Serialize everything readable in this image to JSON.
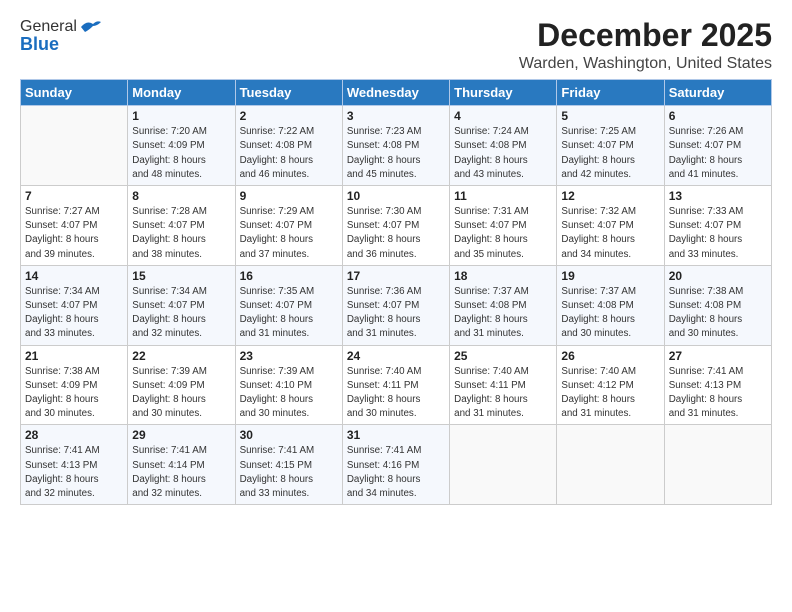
{
  "logo": {
    "line1": "General",
    "line2": "Blue"
  },
  "title": "December 2025",
  "subtitle": "Warden, Washington, United States",
  "days_of_week": [
    "Sunday",
    "Monday",
    "Tuesday",
    "Wednesday",
    "Thursday",
    "Friday",
    "Saturday"
  ],
  "weeks": [
    [
      {
        "day": "",
        "info": ""
      },
      {
        "day": "1",
        "info": "Sunrise: 7:20 AM\nSunset: 4:09 PM\nDaylight: 8 hours\nand 48 minutes."
      },
      {
        "day": "2",
        "info": "Sunrise: 7:22 AM\nSunset: 4:08 PM\nDaylight: 8 hours\nand 46 minutes."
      },
      {
        "day": "3",
        "info": "Sunrise: 7:23 AM\nSunset: 4:08 PM\nDaylight: 8 hours\nand 45 minutes."
      },
      {
        "day": "4",
        "info": "Sunrise: 7:24 AM\nSunset: 4:08 PM\nDaylight: 8 hours\nand 43 minutes."
      },
      {
        "day": "5",
        "info": "Sunrise: 7:25 AM\nSunset: 4:07 PM\nDaylight: 8 hours\nand 42 minutes."
      },
      {
        "day": "6",
        "info": "Sunrise: 7:26 AM\nSunset: 4:07 PM\nDaylight: 8 hours\nand 41 minutes."
      }
    ],
    [
      {
        "day": "7",
        "info": "Sunrise: 7:27 AM\nSunset: 4:07 PM\nDaylight: 8 hours\nand 39 minutes."
      },
      {
        "day": "8",
        "info": "Sunrise: 7:28 AM\nSunset: 4:07 PM\nDaylight: 8 hours\nand 38 minutes."
      },
      {
        "day": "9",
        "info": "Sunrise: 7:29 AM\nSunset: 4:07 PM\nDaylight: 8 hours\nand 37 minutes."
      },
      {
        "day": "10",
        "info": "Sunrise: 7:30 AM\nSunset: 4:07 PM\nDaylight: 8 hours\nand 36 minutes."
      },
      {
        "day": "11",
        "info": "Sunrise: 7:31 AM\nSunset: 4:07 PM\nDaylight: 8 hours\nand 35 minutes."
      },
      {
        "day": "12",
        "info": "Sunrise: 7:32 AM\nSunset: 4:07 PM\nDaylight: 8 hours\nand 34 minutes."
      },
      {
        "day": "13",
        "info": "Sunrise: 7:33 AM\nSunset: 4:07 PM\nDaylight: 8 hours\nand 33 minutes."
      }
    ],
    [
      {
        "day": "14",
        "info": "Sunrise: 7:34 AM\nSunset: 4:07 PM\nDaylight: 8 hours\nand 33 minutes."
      },
      {
        "day": "15",
        "info": "Sunrise: 7:34 AM\nSunset: 4:07 PM\nDaylight: 8 hours\nand 32 minutes."
      },
      {
        "day": "16",
        "info": "Sunrise: 7:35 AM\nSunset: 4:07 PM\nDaylight: 8 hours\nand 31 minutes."
      },
      {
        "day": "17",
        "info": "Sunrise: 7:36 AM\nSunset: 4:07 PM\nDaylight: 8 hours\nand 31 minutes."
      },
      {
        "day": "18",
        "info": "Sunrise: 7:37 AM\nSunset: 4:08 PM\nDaylight: 8 hours\nand 31 minutes."
      },
      {
        "day": "19",
        "info": "Sunrise: 7:37 AM\nSunset: 4:08 PM\nDaylight: 8 hours\nand 30 minutes."
      },
      {
        "day": "20",
        "info": "Sunrise: 7:38 AM\nSunset: 4:08 PM\nDaylight: 8 hours\nand 30 minutes."
      }
    ],
    [
      {
        "day": "21",
        "info": "Sunrise: 7:38 AM\nSunset: 4:09 PM\nDaylight: 8 hours\nand 30 minutes."
      },
      {
        "day": "22",
        "info": "Sunrise: 7:39 AM\nSunset: 4:09 PM\nDaylight: 8 hours\nand 30 minutes."
      },
      {
        "day": "23",
        "info": "Sunrise: 7:39 AM\nSunset: 4:10 PM\nDaylight: 8 hours\nand 30 minutes."
      },
      {
        "day": "24",
        "info": "Sunrise: 7:40 AM\nSunset: 4:11 PM\nDaylight: 8 hours\nand 30 minutes."
      },
      {
        "day": "25",
        "info": "Sunrise: 7:40 AM\nSunset: 4:11 PM\nDaylight: 8 hours\nand 31 minutes."
      },
      {
        "day": "26",
        "info": "Sunrise: 7:40 AM\nSunset: 4:12 PM\nDaylight: 8 hours\nand 31 minutes."
      },
      {
        "day": "27",
        "info": "Sunrise: 7:41 AM\nSunset: 4:13 PM\nDaylight: 8 hours\nand 31 minutes."
      }
    ],
    [
      {
        "day": "28",
        "info": "Sunrise: 7:41 AM\nSunset: 4:13 PM\nDaylight: 8 hours\nand 32 minutes."
      },
      {
        "day": "29",
        "info": "Sunrise: 7:41 AM\nSunset: 4:14 PM\nDaylight: 8 hours\nand 32 minutes."
      },
      {
        "day": "30",
        "info": "Sunrise: 7:41 AM\nSunset: 4:15 PM\nDaylight: 8 hours\nand 33 minutes."
      },
      {
        "day": "31",
        "info": "Sunrise: 7:41 AM\nSunset: 4:16 PM\nDaylight: 8 hours\nand 34 minutes."
      },
      {
        "day": "",
        "info": ""
      },
      {
        "day": "",
        "info": ""
      },
      {
        "day": "",
        "info": ""
      }
    ]
  ]
}
